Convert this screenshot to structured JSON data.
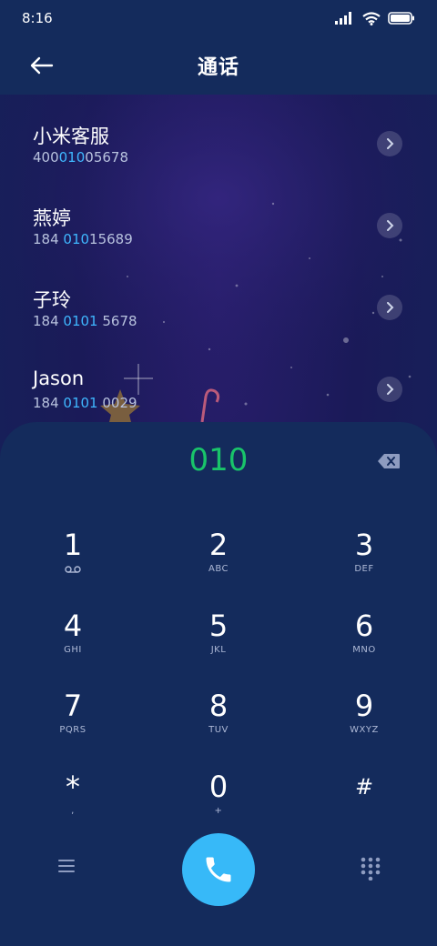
{
  "status_bar": {
    "time": "8:16"
  },
  "header": {
    "title": "通话"
  },
  "contacts": [
    {
      "name": "小米客服",
      "number_pre": "400",
      "number_hl": "010",
      "number_post": "05678"
    },
    {
      "name": "燕婷",
      "number_pre": "184 ",
      "number_hl": "010",
      "number_post": "15689"
    },
    {
      "name": "子玲",
      "number_pre": "184 ",
      "number_hl": "0101",
      "number_post": " 5678"
    },
    {
      "name": "Jason",
      "number_pre": "184 ",
      "number_hl": "0101",
      "number_post": " 0029"
    }
  ],
  "dialer": {
    "display": "010"
  },
  "keypad": [
    {
      "digit": "1",
      "letters": ""
    },
    {
      "digit": "2",
      "letters": "ABC"
    },
    {
      "digit": "3",
      "letters": "DEF"
    },
    {
      "digit": "4",
      "letters": "GHI"
    },
    {
      "digit": "5",
      "letters": "JKL"
    },
    {
      "digit": "6",
      "letters": "MNO"
    },
    {
      "digit": "7",
      "letters": "PQRS"
    },
    {
      "digit": "8",
      "letters": "TUV"
    },
    {
      "digit": "9",
      "letters": "WXYZ"
    },
    {
      "digit": "*",
      "letters": ","
    },
    {
      "digit": "0",
      "letters": "+"
    },
    {
      "digit": "#",
      "letters": ""
    }
  ],
  "colors": {
    "accent_blue": "#37b9f8",
    "highlight_blue": "#3fb7ff",
    "display_green": "#19c46a",
    "panel_bg": "#142b5c"
  },
  "icons": {
    "back": "arrow-left-icon",
    "voicemail": "voicemail-icon",
    "delete": "backspace-icon",
    "menu": "menu-icon",
    "call": "phone-icon",
    "keypad": "keypad-icon"
  }
}
